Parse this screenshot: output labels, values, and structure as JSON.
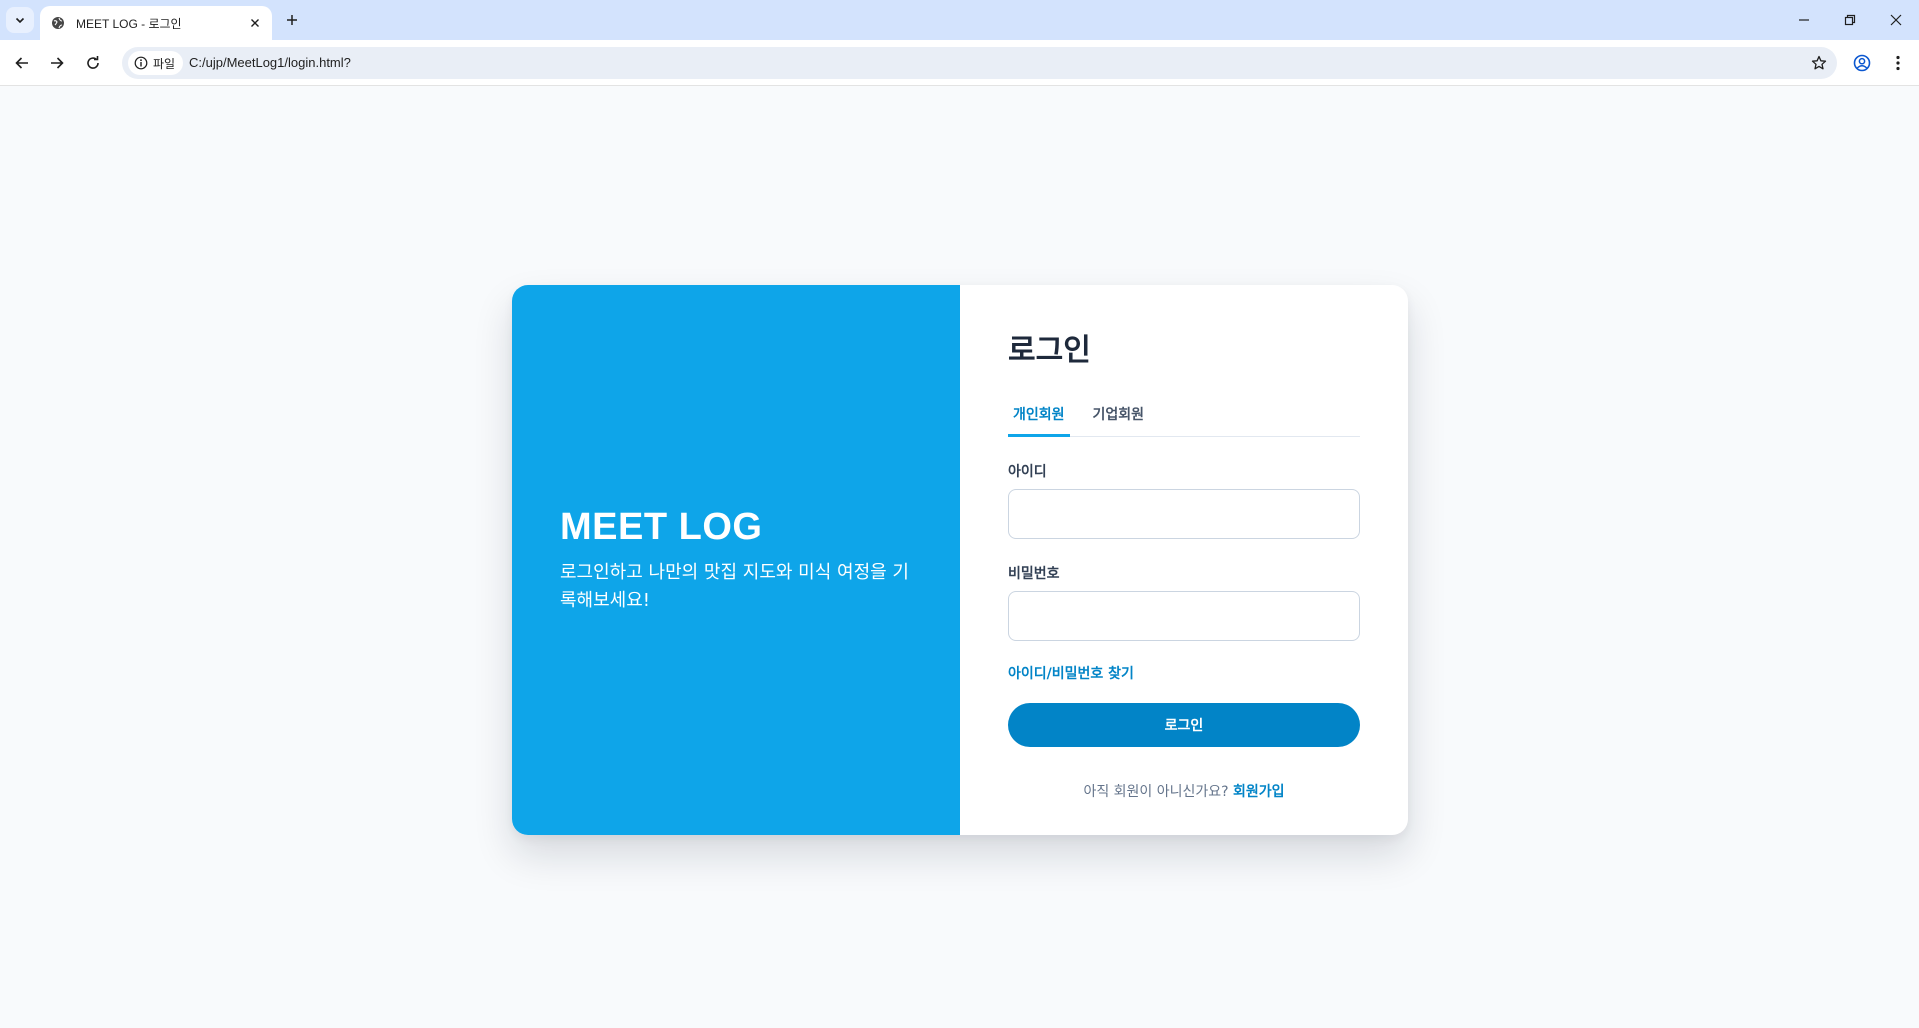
{
  "browser": {
    "tab_title": "MEET LOG - 로그인",
    "security_chip": "파일",
    "url": "C:/ujp/MeetLog1/login.html?"
  },
  "brand": {
    "title": "MEET LOG",
    "subtitle": "로그인하고 나만의 맛집 지도와 미식 여정을 기록해보세요!"
  },
  "form": {
    "title": "로그인",
    "tabs": [
      {
        "label": "개인회원",
        "active": true
      },
      {
        "label": "기업회원",
        "active": false
      }
    ],
    "id_label": "아이디",
    "id_value": "",
    "password_label": "비밀번호",
    "password_value": "",
    "find_link": "아이디/비밀번호 찾기",
    "submit_label": "로그인",
    "signup_prompt": "아직 회원이 아니신가요?",
    "signup_link": "회원가입"
  },
  "colors": {
    "brand_panel": "#0ea5e9",
    "primary": "#0284c7",
    "page_bg": "#f8fafc"
  },
  "icons": [
    "tab-list-icon",
    "globe-icon",
    "close-icon",
    "plus-icon",
    "minimize-icon",
    "restore-icon",
    "window-close-icon",
    "back-arrow-icon",
    "forward-arrow-icon",
    "reload-icon",
    "info-icon",
    "star-icon",
    "profile-icon",
    "menu-dots-icon"
  ]
}
